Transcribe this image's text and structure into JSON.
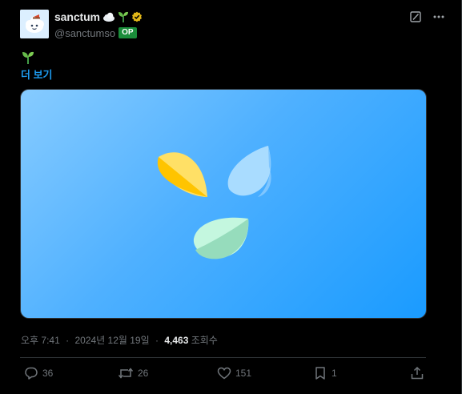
{
  "author": {
    "display_name": "sanctum",
    "name_emojis": [
      "cloud-emoji",
      "seedling-emoji"
    ],
    "verified": true,
    "handle": "@sanctumso",
    "badge": "OP"
  },
  "post": {
    "body_emoji": "seedling-emoji",
    "show_more": "더 보기"
  },
  "media": {
    "background_colors": [
      "#86cbff",
      "#1a9bff"
    ],
    "petal_colors": {
      "yellow": "#ffd43b",
      "blue": "#9fd8ff",
      "green": "#b9f2d6"
    }
  },
  "meta": {
    "time": "오후 7:41",
    "separator": "·",
    "date": "2024년 12월 19일",
    "views": "4,463",
    "views_label": "조회수"
  },
  "actions": {
    "replies": "36",
    "reposts": "26",
    "likes": "151",
    "bookmarks": "1"
  },
  "colors": {
    "accent": "#1d9bf0",
    "muted": "#71767b",
    "text": "#e7e9ea",
    "badge_green": "#1a8d3a",
    "verified_gold": "#e2b719"
  }
}
